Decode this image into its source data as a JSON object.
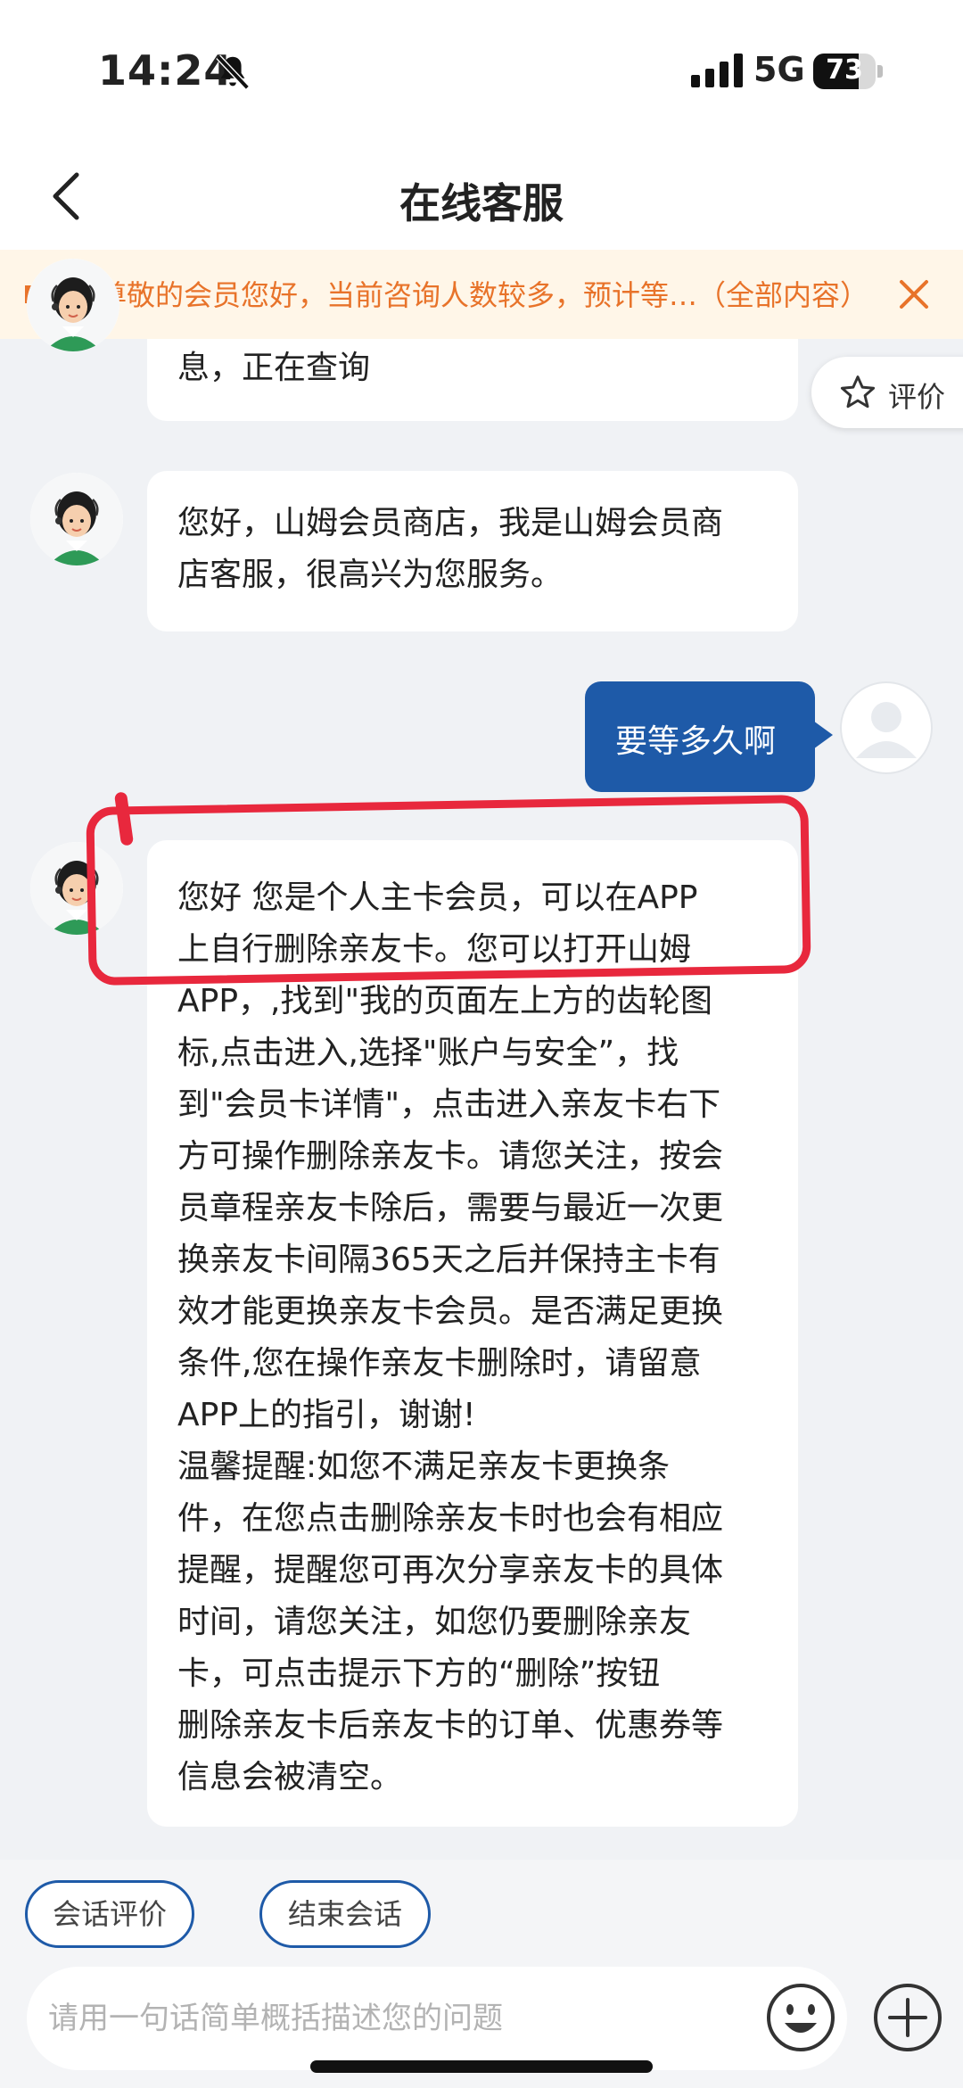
{
  "status_bar": {
    "time": "14:24",
    "network": "5G",
    "battery": "73",
    "battery_level": 0.73
  },
  "header": {
    "title": "在线客服"
  },
  "notice": {
    "text": "尊敬的会员您好，当前咨询人数较多，预计等…（全部内容）"
  },
  "rate_tab": {
    "label": "评价"
  },
  "messages": [
    {
      "from": "agent",
      "text": "息，正在查询"
    },
    {
      "from": "agent",
      "text": "您好，山姆会员商店，我是山姆会员商\n店客服，很高兴为您服务。"
    },
    {
      "from": "user",
      "text": "要等多久啊"
    },
    {
      "from": "agent",
      "text": "您好 您是个人主卡会员，可以在APP\n上自行删除亲友卡。您可以打开山姆\nAPP，,找到\"我的页面左上方的齿轮图\n标,点击进入,选择\"账户与安全”，找\n到\"会员卡详情\"，点击进入亲友卡右下\n方可操作删除亲友卡。请您关注，按会\n员章程亲友卡除后，需要与最近一次更\n换亲友卡间隔365天之后并保持主卡有\n效才能更换亲友卡会员。是否满足更换\n条件,您在操作亲友卡删除时，请留意\nAPP上的指引，谢谢!\n温馨提醒:如您不满足亲友卡更换条\n件，在您点击删除亲友卡时也会有相应\n提醒，提醒您可再次分享亲友卡的具体\n时间，请您关注，如您仍要删除亲友\n卡，可点击提示下方的“删除”按钮\n删除亲友卡后亲友卡的订单、优惠券等\n信息会被清空。"
    }
  ],
  "quick_actions": [
    "会话评价",
    "结束会话"
  ],
  "input": {
    "placeholder": "请用一句话简单概括描述您的问题",
    "value": ""
  },
  "colors": {
    "accent": "#1e5aa8",
    "notice_text": "#e8732a",
    "notice_bg": "#fff6e8",
    "highlight": "#e8283d"
  }
}
